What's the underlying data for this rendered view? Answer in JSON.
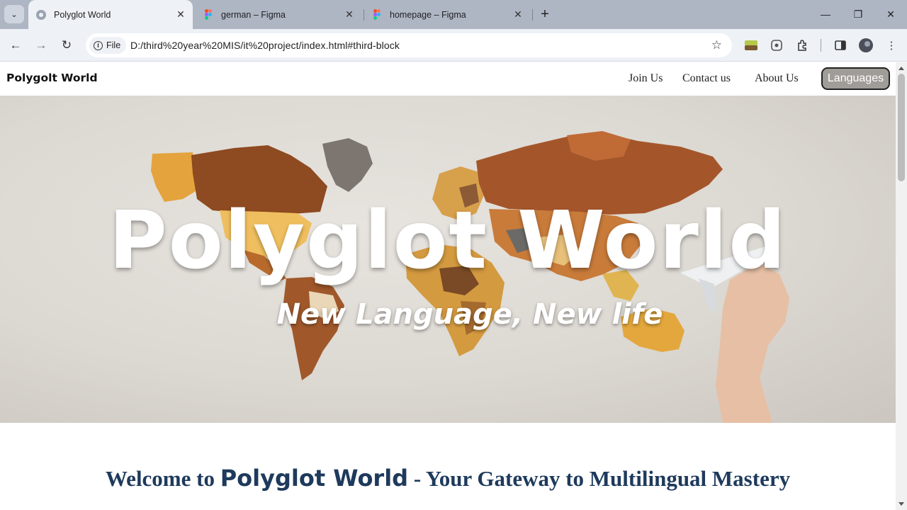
{
  "browser": {
    "tabs": [
      {
        "title": "Polyglot World",
        "active": true,
        "icon": "globe-icon"
      },
      {
        "title": "german – Figma",
        "active": false,
        "icon": "figma-icon"
      },
      {
        "title": "homepage – Figma",
        "active": false,
        "icon": "figma-icon"
      }
    ],
    "address_chip": "File",
    "url": "D:/third%20year%20MIS/it%20project/index.html#third-block"
  },
  "site": {
    "logo": "Polygolt World",
    "nav": {
      "join": "Join Us",
      "contact": "Contact us",
      "about": "About Us",
      "languages": "Languages"
    },
    "hero": {
      "title": "Polyglot World",
      "subtitle": "New Language, New life"
    },
    "welcome": {
      "prefix": "Welcome to ",
      "brand": "Polyglot World",
      "suffix": " - Your Gateway to Multilingual Mastery"
    }
  },
  "colors": {
    "heading": "#1e3a5c",
    "languages_button": "#a09c98"
  }
}
